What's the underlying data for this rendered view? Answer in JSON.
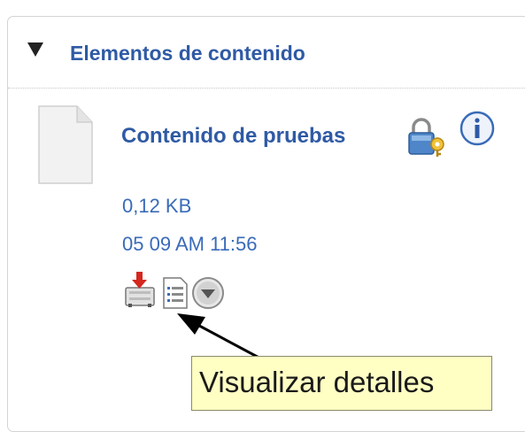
{
  "panel": {
    "title": "Elementos de contenido",
    "toggle_icon": "triangle-down-icon"
  },
  "item": {
    "title": "Contenido de pruebas",
    "size": "0,12 KB",
    "date": "05 09 AM 11:56",
    "file_icon": "document-icon",
    "lock_icon": "lock-key-icon",
    "info_icon": "info-icon"
  },
  "actions": [
    {
      "name": "download",
      "icon": "download-icon"
    },
    {
      "name": "view-details",
      "icon": "details-list-icon"
    },
    {
      "name": "more-actions",
      "icon": "chevron-down-circle-icon"
    }
  ],
  "tooltip": {
    "text": "Visualizar detalles"
  },
  "colors": {
    "link": "#2f5aa5",
    "meta": "#3a6bb8",
    "tooltip_bg": "#ffffc4"
  }
}
